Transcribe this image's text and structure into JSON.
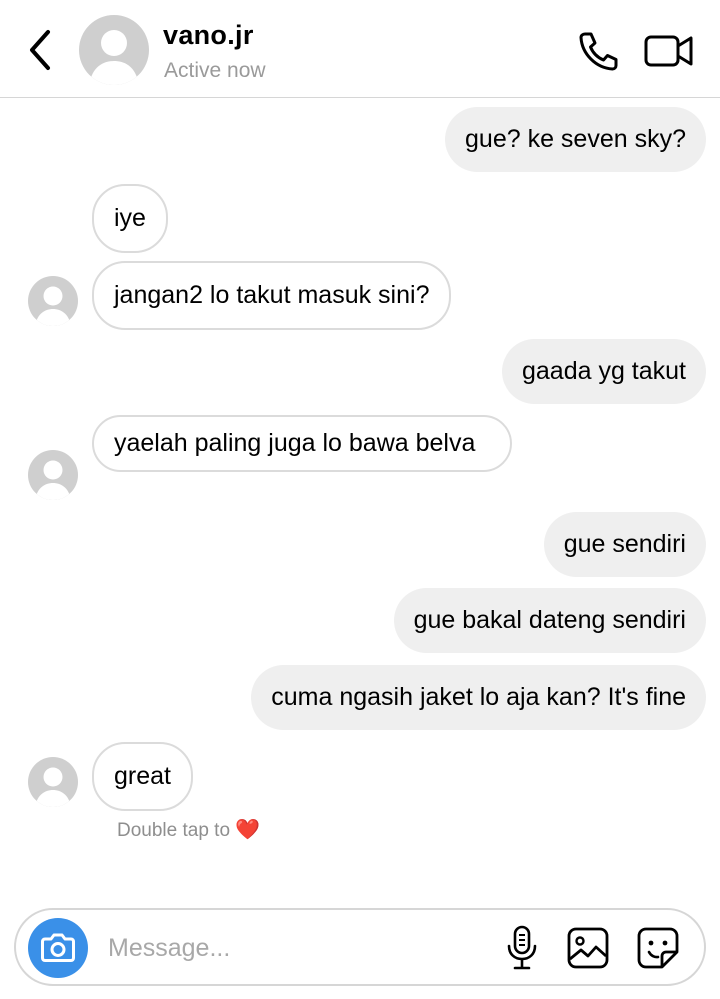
{
  "header": {
    "username": "vano.jr",
    "status": "Active now",
    "icons": [
      "chevron-left-icon",
      "phone-icon",
      "video-camera-icon"
    ]
  },
  "messages": [
    {
      "side": "outgoing",
      "text": "gue? ke seven sky?"
    },
    {
      "side": "incoming",
      "text": "iye"
    },
    {
      "side": "incoming",
      "text": "jangan2 lo takut masuk sini?"
    },
    {
      "side": "outgoing",
      "text": "gaada yg takut"
    },
    {
      "side": "incoming",
      "text": "yaelah paling juga lo bawa belva"
    },
    {
      "side": "outgoing",
      "text": "gue sendiri"
    },
    {
      "side": "outgoing",
      "text": "gue bakal dateng sendiri"
    },
    {
      "side": "outgoing",
      "text": "cuma ngasih jaket lo aja kan? It's fine"
    },
    {
      "side": "incoming",
      "text": "great"
    }
  ],
  "hint": {
    "text": "Double tap to",
    "emoji": "❤️"
  },
  "composer": {
    "placeholder": "Message...",
    "icons": [
      "camera-icon",
      "microphone-icon",
      "gallery-icon",
      "sticker-icon"
    ]
  },
  "colors": {
    "outgoing_bubble": "#efefef",
    "incoming_border": "#dbdbdb",
    "camera_button": "#3a90e8",
    "secondary_text": "#8e8e8e"
  }
}
